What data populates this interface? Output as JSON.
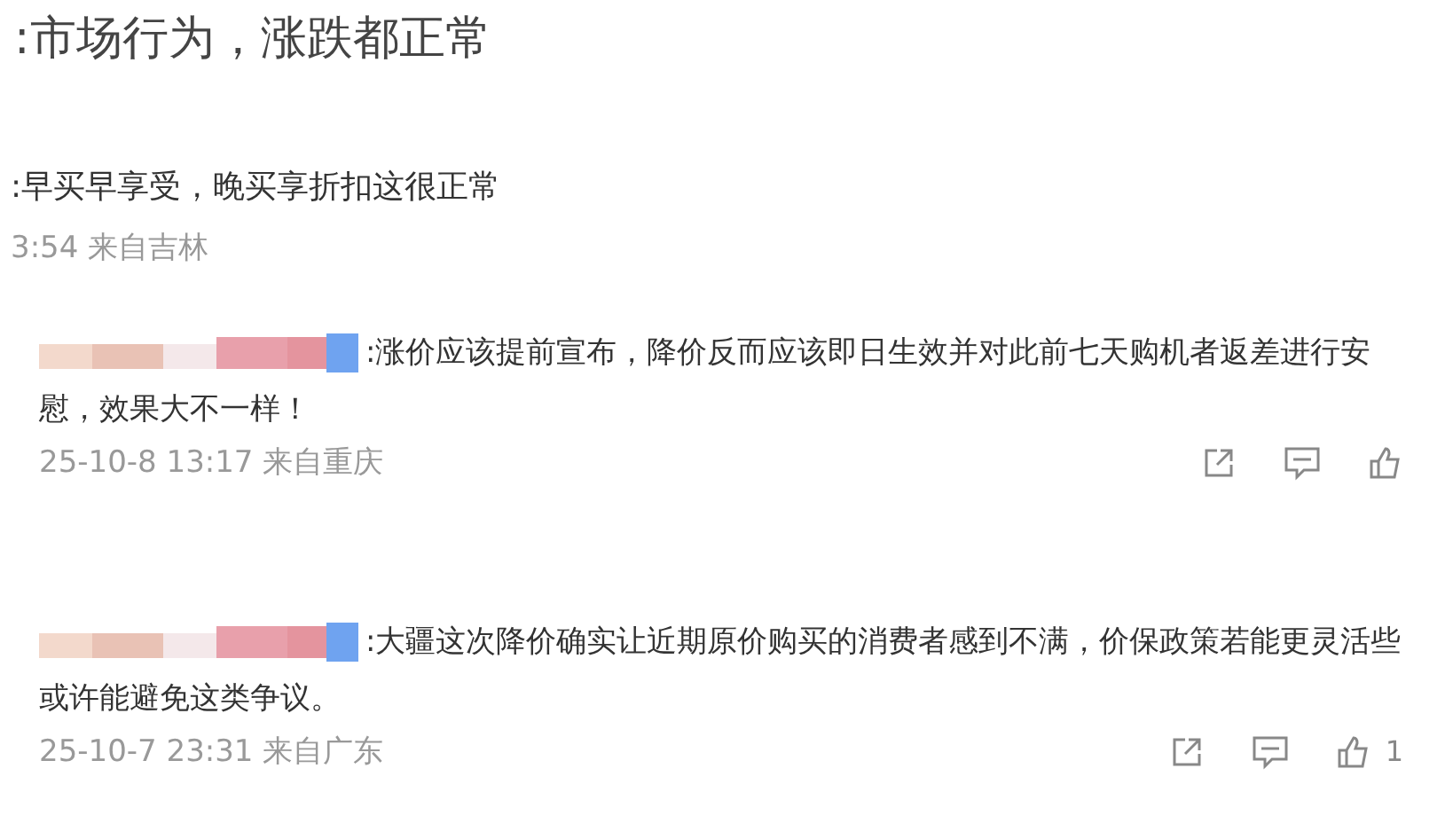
{
  "headline": ":市场行为，涨跌都正常",
  "comments": [
    {
      "redacted": false,
      "text": ":早买早享受，晚买享折扣这很正常",
      "meta": "3:54 来自吉林",
      "actions": false
    },
    {
      "redacted": true,
      "text": ":涨价应该提前宣布，降价反而应该即日生效并对此前七天购机者返差进行安慰，效果大不一样！",
      "meta": "25-10-8 13:17 来自重庆",
      "actions": true
    },
    {
      "redacted": true,
      "text": ":大疆这次降价确实让近期原价购买的消费者感到不满，价保政策若能更灵活些或许能避免这类争议。",
      "meta": "25-10-7 23:31 来自广东",
      "actions": true,
      "like_count": "1"
    }
  ]
}
